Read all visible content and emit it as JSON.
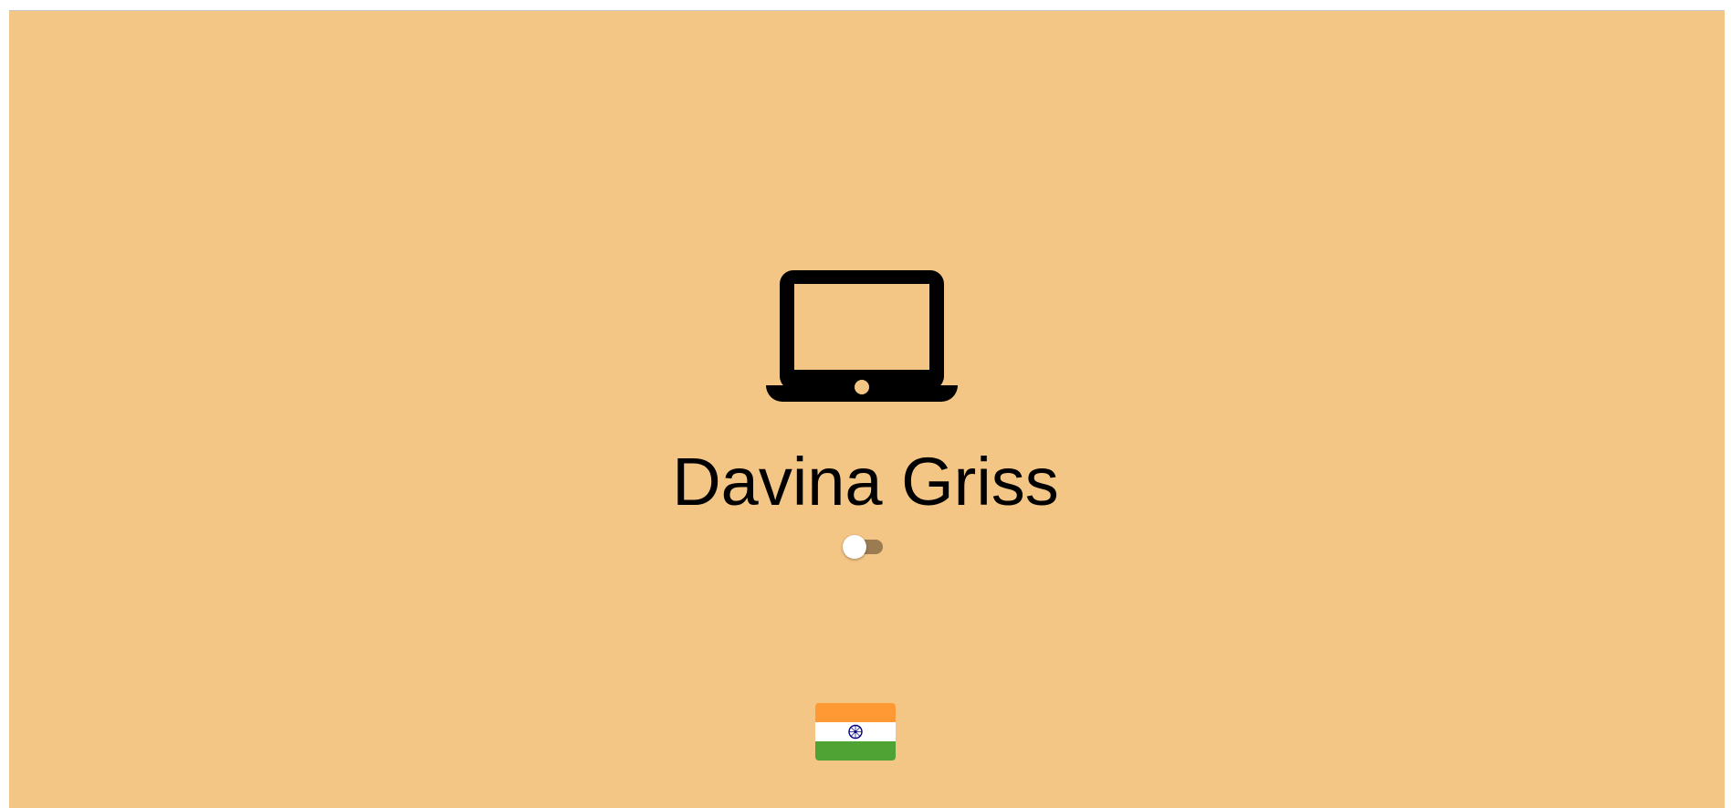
{
  "profile": {
    "name": "Davina Griss",
    "device_icon": "laptop-icon",
    "mode_toggle": {
      "state": "off"
    }
  },
  "footer": {
    "flag_icon": "india-flag-icon"
  },
  "colors": {
    "background": "#f4c686",
    "toggle_track": "#9b7b52",
    "flag_saffron": "#ff9933",
    "flag_white": "#ffffff",
    "flag_green": "#4fa234",
    "flag_chakra": "#000080"
  }
}
